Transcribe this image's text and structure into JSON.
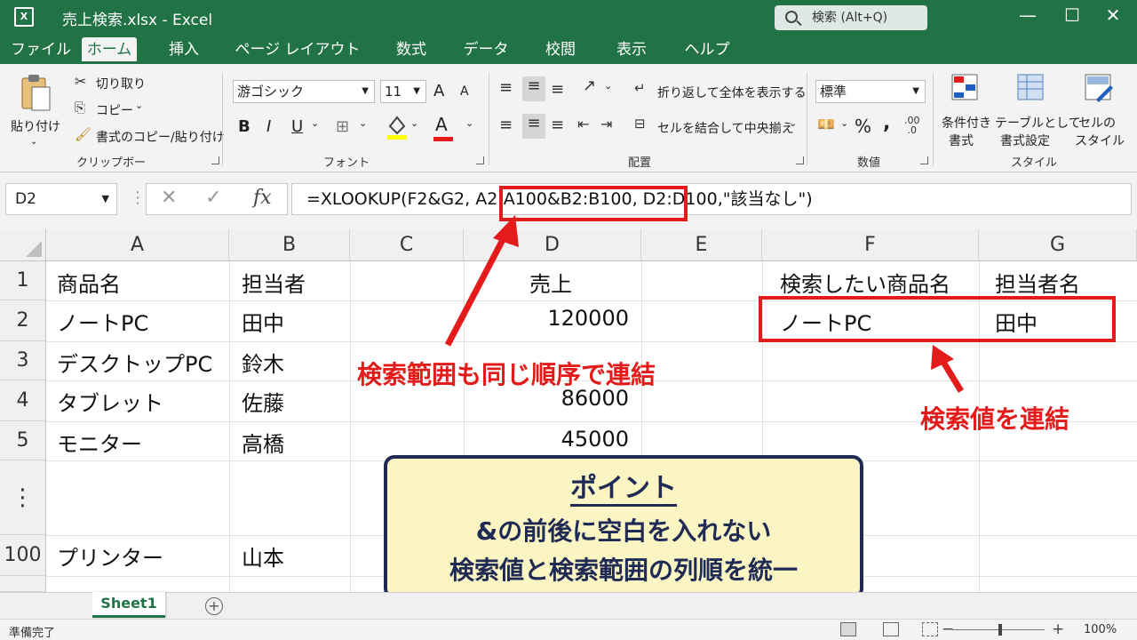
{
  "window": {
    "title": "売上検索.xlsx  -  Excel",
    "search_placeholder": "検索 (Alt+Q)",
    "controls": {
      "minimize": "—",
      "maximize": "☐",
      "close": "✕"
    }
  },
  "tabs": [
    {
      "label": "ファイル"
    },
    {
      "label": "ホーム",
      "active": true
    },
    {
      "label": "挿入"
    },
    {
      "label": "ページ レイアウト"
    },
    {
      "label": "数式"
    },
    {
      "label": "データ"
    },
    {
      "label": "校閲"
    },
    {
      "label": "表示"
    },
    {
      "label": "ヘルプ"
    }
  ],
  "ribbon": {
    "clipboard": {
      "paste": "貼り付け",
      "cut": "切り取り",
      "copy": "コピー",
      "format_painter": "書式のコピー/貼り付け",
      "group": "クリップボード"
    },
    "font": {
      "font_name": "游ゴシック",
      "font_size": "11",
      "grow": "A",
      "shrink": "A",
      "bold": "B",
      "italic": "I",
      "underline": "U",
      "font_color_glyph": "A",
      "group": "フォント"
    },
    "alignment": {
      "wrap_text": "折り返して全体を表示する",
      "merge_center": "セルを結合して中央揃え",
      "group": "配置"
    },
    "number": {
      "format": "標準",
      "percent": "%",
      "comma": ",",
      "group": "数値"
    },
    "styles": {
      "conditional_1": "条件付き",
      "conditional_2": "書式",
      "table_1": "テーブルとして",
      "table_2": "書式設定",
      "cell_1": "セルの",
      "cell_2": "スタイル",
      "group": "スタイル"
    }
  },
  "formula_bar": {
    "name_box": "D2",
    "fx": "fx",
    "formula": "=XLOOKUP(F2&G2, A2:A100&B2:B100, D2:D100,\"該当なし\")"
  },
  "grid": {
    "columns": [
      "A",
      "B",
      "C",
      "D",
      "E",
      "F",
      "G"
    ],
    "rows": [
      {
        "label": "1",
        "cells": {
          "A": "商品名",
          "B": "担当者",
          "D": "売上",
          "F": "検索したい商品名",
          "G": "担当者名"
        }
      },
      {
        "label": "2",
        "cells": {
          "A": "ノートPC",
          "B": "田中",
          "D": "120000",
          "F": "ノートPC",
          "G": "田中"
        }
      },
      {
        "label": "3",
        "cells": {
          "A": "デスクトップPC",
          "B": "鈴木"
        }
      },
      {
        "label": "4",
        "cells": {
          "A": "タブレット",
          "B": "佐藤",
          "D": "86000"
        }
      },
      {
        "label": "5",
        "cells": {
          "A": "モニター",
          "B": "高橋",
          "D": "45000"
        }
      },
      {
        "label": "⋮",
        "cells": {}
      },
      {
        "label": "100",
        "cells": {
          "A": "プリンター",
          "B": "山本"
        }
      }
    ]
  },
  "annotations": {
    "range_note": "検索範囲も同じ順序で連結",
    "value_note": "検索値を連結",
    "accent_color": "#e31b1b"
  },
  "point_box": {
    "title": "ポイント",
    "line1": "&の前後に空白を入れない",
    "line2": "検索値と検索範囲の列順を統一"
  },
  "sheets": {
    "active": "Sheet1",
    "add": "+"
  },
  "status": {
    "ready": "準備完了",
    "zoom": "100%",
    "zoom_minus": "−",
    "zoom_plus": "+"
  },
  "colors": {
    "excel_green": "#217346",
    "point_navy": "#1f2b55",
    "point_fill": "#fbf4c3"
  }
}
